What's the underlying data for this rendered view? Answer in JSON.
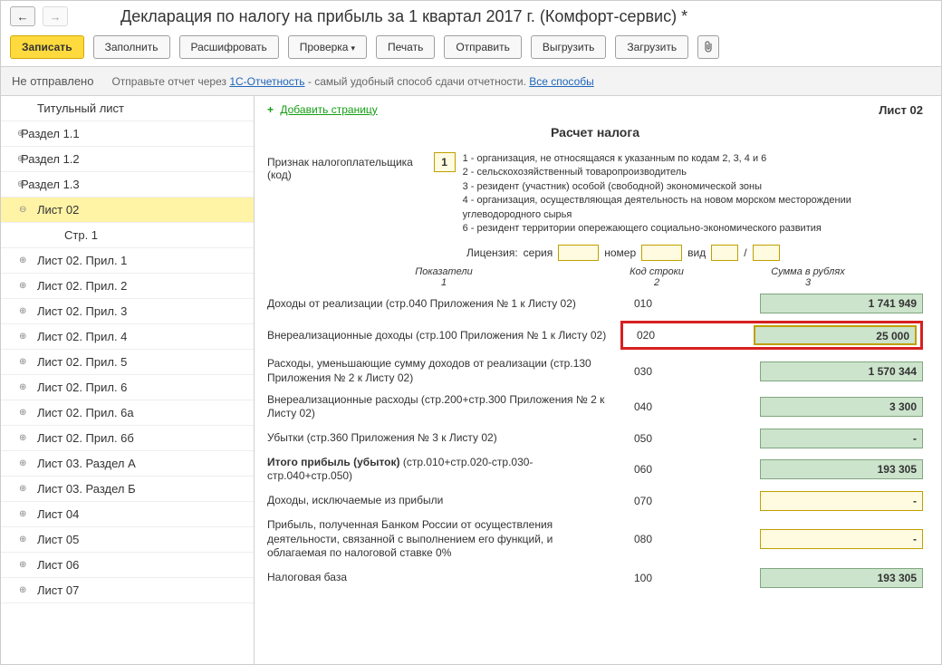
{
  "title": "Декларация по налогу на прибыль за 1 квартал 2017 г. (Комфорт-сервис) *",
  "toolbar": {
    "save": "Записать",
    "fill": "Заполнить",
    "decode": "Расшифровать",
    "check": "Проверка",
    "print": "Печать",
    "send": "Отправить",
    "export": "Выгрузить",
    "import": "Загрузить"
  },
  "status": {
    "state": "Не отправлено",
    "msg1": "Отправьте отчет через ",
    "link1": "1С-Отчетность",
    "msg2": " - самый удобный способ сдачи отчетности. ",
    "link2": "Все способы"
  },
  "tree": [
    {
      "label": "Титульный лист",
      "level": 1,
      "exp": ""
    },
    {
      "label": "Раздел 1.1",
      "level": 0,
      "exp": "⊕"
    },
    {
      "label": "Раздел 1.2",
      "level": 0,
      "exp": "⊕"
    },
    {
      "label": "Раздел 1.3",
      "level": 0,
      "exp": "⊕"
    },
    {
      "label": "Лист 02",
      "level": 1,
      "exp": "⊖",
      "selected": true
    },
    {
      "label": "Стр. 1",
      "level": 2,
      "exp": ""
    },
    {
      "label": "Лист 02. Прил. 1",
      "level": 1,
      "exp": "⊕"
    },
    {
      "label": "Лист 02. Прил. 2",
      "level": 1,
      "exp": "⊕"
    },
    {
      "label": "Лист 02. Прил. 3",
      "level": 1,
      "exp": "⊕"
    },
    {
      "label": "Лист 02. Прил. 4",
      "level": 1,
      "exp": "⊕"
    },
    {
      "label": "Лист 02. Прил. 5",
      "level": 1,
      "exp": "⊕"
    },
    {
      "label": "Лист 02. Прил. 6",
      "level": 1,
      "exp": "⊕"
    },
    {
      "label": "Лист 02. Прил. 6а",
      "level": 1,
      "exp": "⊕"
    },
    {
      "label": "Лист 02. Прил. 6б",
      "level": 1,
      "exp": "⊕"
    },
    {
      "label": "Лист 03. Раздел А",
      "level": 1,
      "exp": "⊕"
    },
    {
      "label": "Лист 03. Раздел Б",
      "level": 1,
      "exp": "⊕"
    },
    {
      "label": "Лист 04",
      "level": 1,
      "exp": "⊕"
    },
    {
      "label": "Лист 05",
      "level": 1,
      "exp": "⊕"
    },
    {
      "label": "Лист 06",
      "level": 1,
      "exp": "⊕"
    },
    {
      "label": "Лист 07",
      "level": 1,
      "exp": "⊕"
    }
  ],
  "content": {
    "add_page": "Добавить страницу",
    "sheet": "Лист 02",
    "section_title": "Расчет налога",
    "taxpayer_label": "Признак налогоплательщика (код)",
    "taxpayer_code": "1",
    "legend": [
      "1 - организация, не относящаяся к указанным по кодам 2, 3, 4 и 6",
      "2 - сельскохозяйственный товаропроизводитель",
      "3 - резидент (участник) особой (свободной) экономической зоны",
      "4 - организация, осуществляющая деятельность на новом морском месторождении углеводородного сырья",
      "6 - резидент территории опережающего социально-экономического развития"
    ],
    "license": {
      "label": "Лицензия:",
      "serie": "серия",
      "number": "номер",
      "kind": "вид",
      "slash": "/"
    },
    "col_headers": {
      "c1": "Показатели",
      "c1n": "1",
      "c2": "Код строки",
      "c2n": "2",
      "c3": "Сумма в рублях",
      "c3n": "3"
    },
    "rows": [
      {
        "ind": "Доходы от реализации (стр.040 Приложения № 1 к Листу 02)",
        "code": "010",
        "val": "1 741 949",
        "style": "green"
      },
      {
        "ind": "Внереализационные доходы (стр.100 Приложения № 1 к Листу 02)",
        "code": "020",
        "val": "25 000",
        "style": "highlight"
      },
      {
        "ind": "Расходы, уменьшающие сумму доходов от реализации (стр.130 Приложения № 2 к Листу 02)",
        "code": "030",
        "val": "1 570 344",
        "style": "green"
      },
      {
        "ind": "Внереализационные расходы (стр.200+стр.300 Приложения № 2 к Листу 02)",
        "code": "040",
        "val": "3 300",
        "style": "green"
      },
      {
        "ind": "Убытки (стр.360 Приложения № 3 к Листу 02)",
        "code": "050",
        "val": "-",
        "style": "green"
      },
      {
        "ind_bold": "Итого прибыль (убыток)",
        "ind_sub": "  (стр.010+стр.020-стр.030-стр.040+стр.050)",
        "code": "060",
        "val": "193 305",
        "style": "green",
        "totals": true
      },
      {
        "ind": "Доходы, исключаемые из прибыли",
        "code": "070",
        "val": "-",
        "style": "yellow"
      },
      {
        "ind": "Прибыль, полученная Банком России от осуществления деятельности, связанной с выполнением его функций, и облагаемая по налоговой ставке 0%",
        "code": "080",
        "val": "-",
        "style": "yellow"
      },
      {
        "ind": "Налоговая база",
        "code": "100",
        "val": "193 305",
        "style": "green"
      }
    ]
  }
}
